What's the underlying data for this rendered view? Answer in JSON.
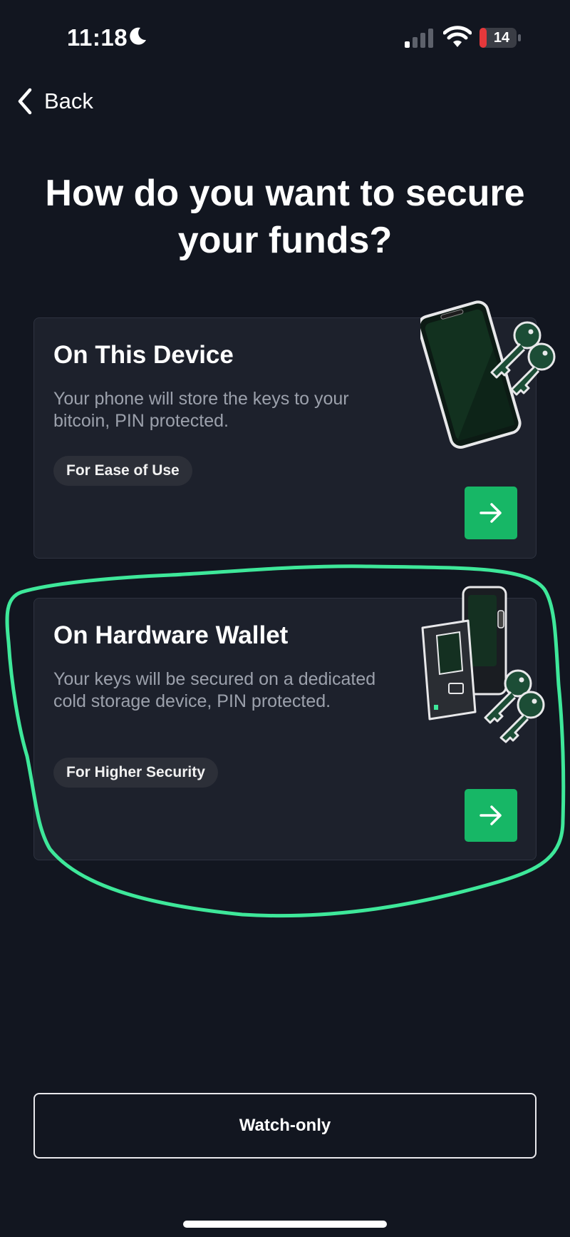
{
  "status_bar": {
    "time": "11:18",
    "battery_level": "14",
    "icons": [
      "moon-icon",
      "cellular-signal-icon",
      "wifi-icon",
      "battery-icon"
    ]
  },
  "nav": {
    "back_label": "Back"
  },
  "page": {
    "title": "How do you want to secure your funds?"
  },
  "options": [
    {
      "title": "On This Device",
      "description": "Your phone will store the keys to your bitcoin, PIN protected.",
      "tag": "For Ease of Use",
      "icon": "arrow-right-icon"
    },
    {
      "title": "On Hardware Wallet",
      "description": "Your keys will be secured on a dedicated cold storage device, PIN protected.",
      "tag": "For Higher Security",
      "icon": "arrow-right-icon"
    }
  ],
  "footer": {
    "watch_only_label": "Watch-only"
  },
  "colors": {
    "background": "#121620",
    "card": "#1d212c",
    "accent_green": "#17b766",
    "annotation_green": "#3ee89a"
  }
}
